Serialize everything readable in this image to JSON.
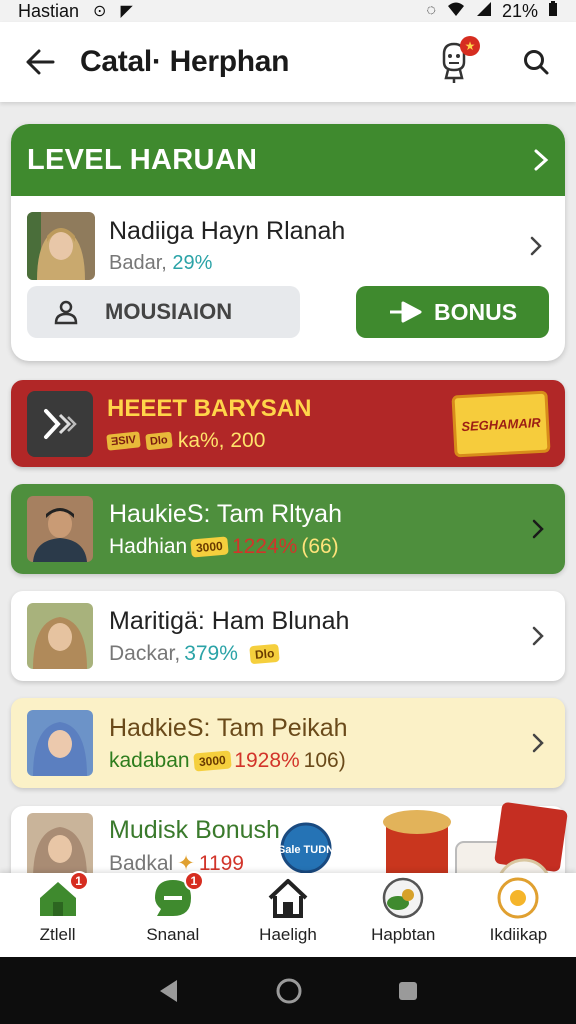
{
  "status_bar": {
    "carrier": "Hastian",
    "battery": "21%"
  },
  "app_bar": {
    "title": "Catal· Herphan",
    "mascot_badge": "★"
  },
  "level_card": {
    "title": "LEVEL HARUAN",
    "user_name": "Nadiiga Hayn Rlanah",
    "user_sub_label": "Badar,",
    "user_sub_pct": "29%",
    "mission_label": "MOUSIAION",
    "bonus_label": "BONUS"
  },
  "promo": {
    "title": "HEEET BARYSAN",
    "tag1": "ƎSIV",
    "tag2": "Dlo",
    "sub_text": "ka%, 200",
    "sign": "SEGHAMAIR"
  },
  "rows": [
    {
      "name": "HaukieS: Tam Rltyah",
      "sub_label": "Hadhian",
      "chip": "3000",
      "pct": "1224%",
      "extra": "(66)"
    },
    {
      "name": "Maritigä: Ham Blunah",
      "sub_label": "Dackar,",
      "pct": "379%",
      "chip": "Dlo"
    },
    {
      "name": "HadkieS: Tam Peikah",
      "sub_label": "kadaban",
      "chip": "3000",
      "pct": "1928%",
      "extra": "106)"
    },
    {
      "name": "Mudisk Bonush",
      "sub_label": "Badkal",
      "pct": "1199",
      "badge": "Sale TUDN"
    }
  ],
  "bottom_nav": [
    {
      "label": "Ztlell",
      "badge": "1"
    },
    {
      "label": "Snanal",
      "badge": "1"
    },
    {
      "label": "Haeligh"
    },
    {
      "label": "Hapbtan"
    },
    {
      "label": "Ikdiikap"
    }
  ],
  "colors": {
    "brand_green": "#3f8a2e",
    "promo_red": "#b12727",
    "accent_gold": "#f5cf3d",
    "badge_red": "#d62d20"
  }
}
